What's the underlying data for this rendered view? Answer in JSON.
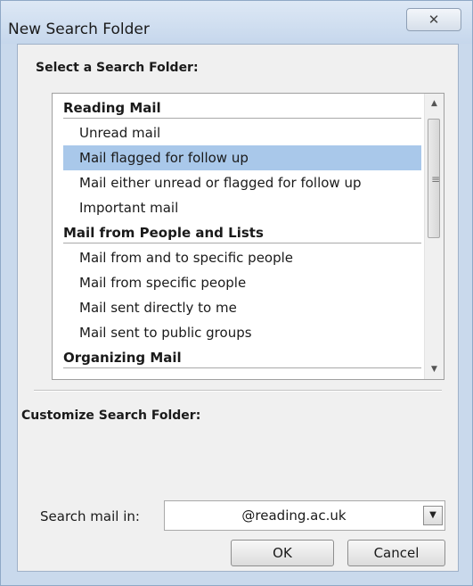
{
  "window": {
    "title": "New Search Folder",
    "close_glyph": "✕"
  },
  "select_section": {
    "label": "Select a Search Folder:"
  },
  "list": [
    {
      "kind": "header",
      "label": "Reading Mail"
    },
    {
      "kind": "item",
      "label": "Unread mail"
    },
    {
      "kind": "item",
      "label": "Mail flagged for follow up",
      "selected": true
    },
    {
      "kind": "item",
      "label": "Mail either unread or flagged for follow up"
    },
    {
      "kind": "item",
      "label": "Important mail"
    },
    {
      "kind": "header",
      "label": "Mail from People and Lists"
    },
    {
      "kind": "item",
      "label": "Mail from and to specific people"
    },
    {
      "kind": "item",
      "label": "Mail from specific people"
    },
    {
      "kind": "item",
      "label": "Mail sent directly to me"
    },
    {
      "kind": "item",
      "label": "Mail sent to public groups"
    },
    {
      "kind": "header",
      "label": "Organizing Mail"
    }
  ],
  "scrollbar": {
    "up_arrow": "▲",
    "down_arrow": "▼",
    "grip": "≡"
  },
  "customize_section": {
    "label": "Customize Search Folder:"
  },
  "search_in": {
    "label": "Search mail in:",
    "value": "@reading.ac.uk",
    "dropdown_glyph": "▼"
  },
  "buttons": {
    "ok": "OK",
    "cancel": "Cancel"
  },
  "colors": {
    "selection": "#a9c8ea",
    "frame": "#c9d9ec",
    "dialog_bg": "#f0f0f0"
  }
}
